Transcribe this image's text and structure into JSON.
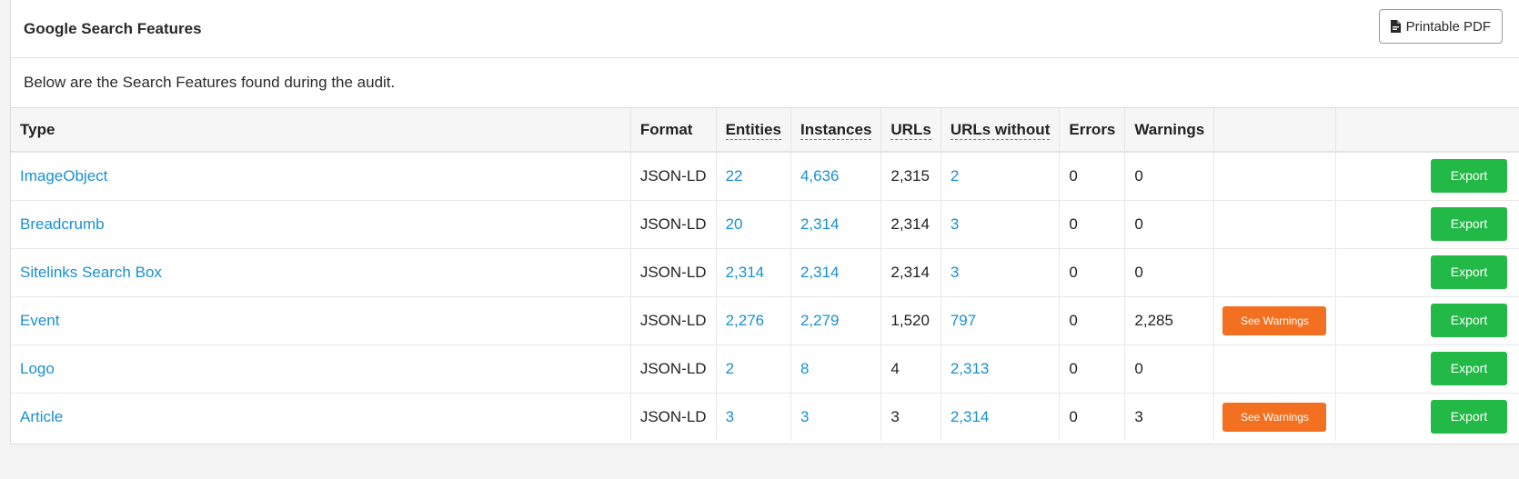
{
  "header": {
    "title": "Google Search Features",
    "pdf_button_label": "Printable PDF"
  },
  "intro": "Below are the Search Features found during the audit.",
  "table": {
    "columns": [
      "Type",
      "Format",
      "Entities",
      "Instances",
      "URLs",
      "URLs without",
      "Errors",
      "Warnings",
      "",
      ""
    ],
    "warnings_button_label": "See Warnings",
    "export_button_label": "Export",
    "rows": [
      {
        "type": "ImageObject",
        "format": "JSON-LD",
        "entities": "22",
        "instances": "4,636",
        "urls": "2,315",
        "urls_without": "2",
        "errors": "0",
        "warnings": "0",
        "has_warnings_button": false
      },
      {
        "type": "Breadcrumb",
        "format": "JSON-LD",
        "entities": "20",
        "instances": "2,314",
        "urls": "2,314",
        "urls_without": "3",
        "errors": "0",
        "warnings": "0",
        "has_warnings_button": false
      },
      {
        "type": "Sitelinks Search Box",
        "format": "JSON-LD",
        "entities": "2,314",
        "instances": "2,314",
        "urls": "2,314",
        "urls_without": "3",
        "errors": "0",
        "warnings": "0",
        "has_warnings_button": false
      },
      {
        "type": "Event",
        "format": "JSON-LD",
        "entities": "2,276",
        "instances": "2,279",
        "urls": "1,520",
        "urls_without": "797",
        "errors": "0",
        "warnings": "2,285",
        "has_warnings_button": true
      },
      {
        "type": "Logo",
        "format": "JSON-LD",
        "entities": "2",
        "instances": "8",
        "urls": "4",
        "urls_without": "2,313",
        "errors": "0",
        "warnings": "0",
        "has_warnings_button": false
      },
      {
        "type": "Article",
        "format": "JSON-LD",
        "entities": "3",
        "instances": "3",
        "urls": "3",
        "urls_without": "2,314",
        "errors": "0",
        "warnings": "3",
        "has_warnings_button": true
      }
    ]
  },
  "colors": {
    "link": "#1a8fd0",
    "warnings_button": "#f37021",
    "export_button": "#22b946"
  },
  "icons": {
    "pdf": "file-pdf-icon"
  }
}
